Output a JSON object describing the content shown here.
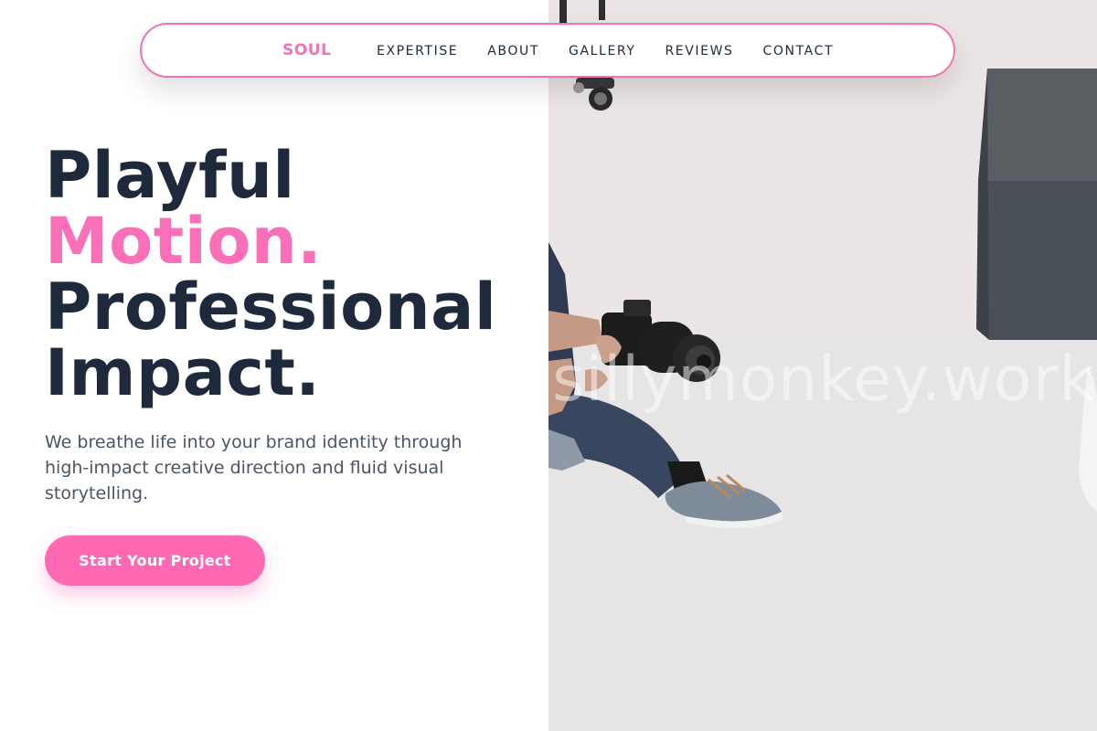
{
  "brand": {
    "logo": "SOUL",
    "accent_color": "#ff69b4"
  },
  "nav": {
    "links": [
      "EXPERTISE",
      "ABOUT",
      "GALLERY",
      "REVIEWS",
      "CONTACT"
    ]
  },
  "hero": {
    "headline_line1": "Playful",
    "headline_line2": "Motion.",
    "headline_line3": "Professional",
    "headline_line4": "Impact.",
    "subtitle": "We breathe life into your brand identity through high-impact creative direction and fluid visual storytelling.",
    "cta_label": "Start Your Project"
  },
  "photo": {
    "watermark": "sillymonkey.work"
  }
}
